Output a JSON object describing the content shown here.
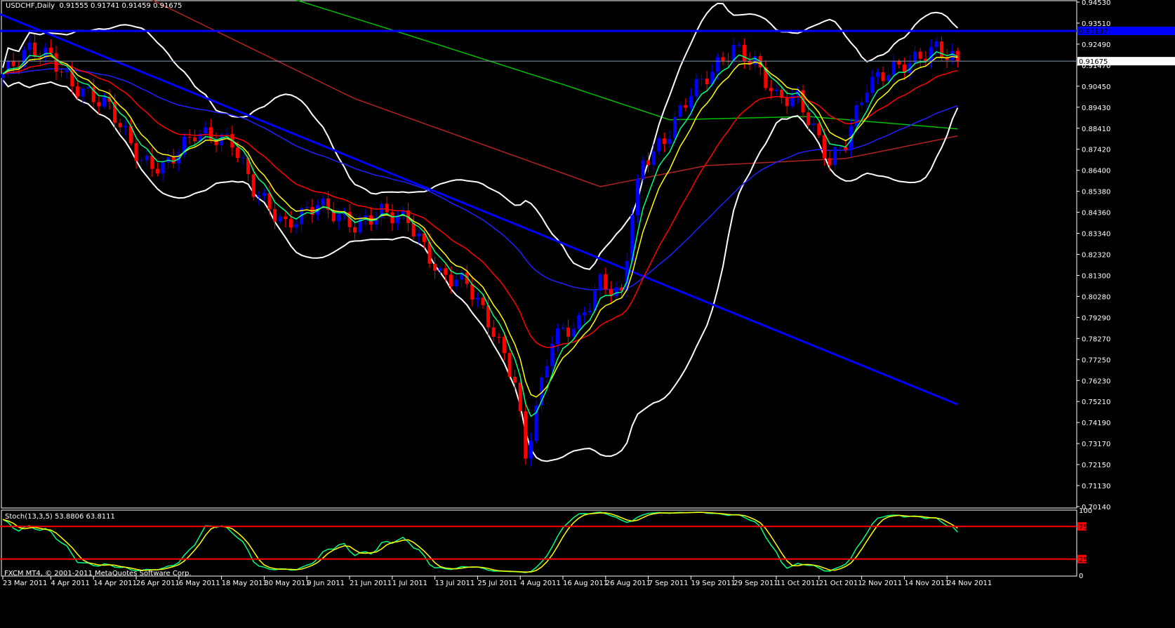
{
  "header": {
    "symbol": "USDCHF,Daily",
    "ohlc": "0.91555 0.91741 0.91459 0.91675"
  },
  "stoch_pane": {
    "title": "Stoch(13,3,5) 53.8806 63.8111",
    "levels": [
      "100",
      "75",
      "25",
      "0"
    ]
  },
  "footer": {
    "copyright": "FXCM MT4, © 2001-2011 MetaQuotes Software Corp."
  },
  "colors": {
    "bull": "#0000ff",
    "bear": "#ff0000",
    "ma5": "#00ff7f",
    "ma8": "#ffff00",
    "ma21": "#ff0000",
    "ma55": "#2020ff",
    "ma100": "#00c000",
    "ma200": "#b22222",
    "bands": "#ffffff",
    "trend": "#0000ff",
    "stoch_main": "#00ff7f",
    "stoch_signal": "#ffff00",
    "levels": "#ff0000"
  },
  "chart_data": {
    "type": "candlestick",
    "title": "USDCHF,Daily",
    "ylim": [
      0.7014,
      0.9453
    ],
    "y_ticks": [
      "0.94530",
      "0.93510",
      "0.92490",
      "0.91470",
      "0.90450",
      "0.89430",
      "0.88410",
      "0.87420",
      "0.86400",
      "0.85380",
      "0.84360",
      "0.83340",
      "0.82320",
      "0.81300",
      "0.80280",
      "0.79290",
      "0.78270",
      "0.77250",
      "0.76230",
      "0.75210",
      "0.74190",
      "0.73170",
      "0.72150",
      "0.71130",
      "0.70140"
    ],
    "bar_count": 180,
    "close_path": [
      [
        0,
        0.9106
      ],
      [
        5,
        0.9225
      ],
      [
        9,
        0.919
      ],
      [
        13,
        0.905
      ],
      [
        20,
        0.895
      ],
      [
        26,
        0.868
      ],
      [
        30,
        0.865
      ],
      [
        36,
        0.882
      ],
      [
        43,
        0.878
      ],
      [
        47,
        0.855
      ],
      [
        53,
        0.837
      ],
      [
        59,
        0.848
      ],
      [
        66,
        0.837
      ],
      [
        71,
        0.844
      ],
      [
        76,
        0.84
      ],
      [
        82,
        0.813
      ],
      [
        87,
        0.81
      ],
      [
        92,
        0.786
      ],
      [
        96,
        0.762
      ],
      [
        98,
        0.725
      ],
      [
        100,
        0.749
      ],
      [
        103,
        0.783
      ],
      [
        108,
        0.79
      ],
      [
        112,
        0.81
      ],
      [
        116,
        0.803
      ],
      [
        118,
        0.844
      ],
      [
        120,
        0.868
      ],
      [
        124,
        0.878
      ],
      [
        129,
        0.902
      ],
      [
        133,
        0.912
      ],
      [
        137,
        0.923
      ],
      [
        141,
        0.916
      ],
      [
        145,
        0.899
      ],
      [
        149,
        0.899
      ],
      [
        151,
        0.889
      ],
      [
        155,
        0.868
      ],
      [
        158,
        0.878
      ],
      [
        162,
        0.905
      ],
      [
        166,
        0.912
      ],
      [
        170,
        0.916
      ],
      [
        175,
        0.923
      ],
      [
        179,
        0.91675
      ]
    ],
    "ma100_path": [
      [
        55,
        0.9463
      ],
      [
        74,
        0.931
      ],
      [
        105,
        0.9055
      ],
      [
        125,
        0.8884
      ],
      [
        151,
        0.89
      ],
      [
        179,
        0.884
      ]
    ],
    "ma200_path": [
      [
        28,
        0.9463
      ],
      [
        66,
        0.8986
      ],
      [
        112,
        0.8561
      ],
      [
        132,
        0.8663
      ],
      [
        158,
        0.8697
      ],
      [
        179,
        0.8806
      ]
    ],
    "horizontal_line": {
      "price": 0.93137,
      "label": "0.93137"
    },
    "current_price": {
      "price": 0.91675,
      "label": "0.91675"
    },
    "trendline": [
      [
        0,
        0.9395
      ],
      [
        179,
        0.7508
      ]
    ],
    "date_labels": [
      [
        0,
        "23 Mar 2011"
      ],
      [
        9,
        "4 Apr 2011"
      ],
      [
        17,
        "14 Apr 2011"
      ],
      [
        25,
        "26 Apr 2011"
      ],
      [
        33,
        "6 May 2011"
      ],
      [
        41,
        "18 May 2011"
      ],
      [
        49,
        "30 May 2011"
      ],
      [
        57,
        "9 Jun 2011"
      ],
      [
        65,
        "21 Jun 2011"
      ],
      [
        73,
        "1 Jul 2011"
      ],
      [
        81,
        "13 Jul 2011"
      ],
      [
        89,
        "25 Jul 2011"
      ],
      [
        97,
        "4 Aug 2011"
      ],
      [
        105,
        "16 Aug 2011"
      ],
      [
        113,
        "26 Aug 2011"
      ],
      [
        121,
        "7 Sep 2011"
      ],
      [
        129,
        "19 Sep 2011"
      ],
      [
        137,
        "29 Sep 2011"
      ],
      [
        145,
        "11 Oct 2011"
      ],
      [
        153,
        "21 Oct 2011"
      ],
      [
        161,
        "2 Nov 2011"
      ],
      [
        169,
        "14 Nov 2011"
      ],
      [
        177,
        "24 Nov 2011"
      ]
    ],
    "stoch": {
      "k": 13,
      "d": 3,
      "slowing": 5,
      "main": 53.8806,
      "signal": 63.8111,
      "levels": [
        75,
        25
      ],
      "ylim": [
        0,
        100
      ]
    }
  }
}
